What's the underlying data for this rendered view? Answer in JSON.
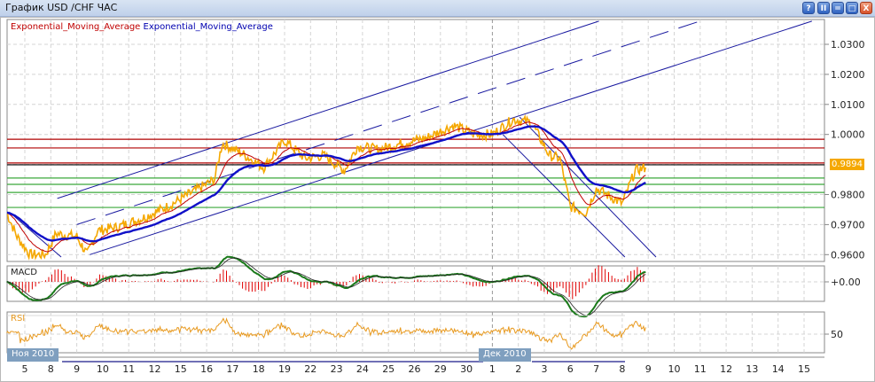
{
  "window": {
    "title": "График USD /CHF  ЧАС",
    "buttons": [
      "?",
      "II",
      "=",
      "□",
      "X"
    ]
  },
  "chart_data": {
    "type": "line",
    "title": "График USD /CHF  ЧАС",
    "legend": [
      {
        "label": "Exponential_Moving_Average",
        "color": "#c00000"
      },
      {
        "label": "Exponential_Moving_Average",
        "color": "#0000b0"
      }
    ],
    "x_ticks": [
      "5",
      "8",
      "9",
      "10",
      "11",
      "12",
      "15",
      "16",
      "17",
      "18",
      "19",
      "22",
      "23",
      "24",
      "25",
      "26",
      "29",
      "30",
      "1",
      "2",
      "3",
      "6",
      "7",
      "8",
      "9",
      "10",
      "11",
      "12",
      "13",
      "14",
      "15"
    ],
    "months": [
      {
        "label": "Ноя 2010",
        "index": 0
      },
      {
        "label": "Дек 2010",
        "index": 18
      }
    ],
    "y_ticks": [
      "1.0300",
      "1.0200",
      "1.0100",
      "1.0000",
      "0.9800",
      "0.9700",
      "0.9600"
    ],
    "y_tick_values": [
      1.03,
      1.02,
      1.01,
      1.0,
      0.98,
      0.97,
      0.96
    ],
    "ylim": [
      0.9555,
      1.0385
    ],
    "last_price": "0.9894",
    "price_keypoints": [
      [
        -0.7,
        0.974
      ],
      [
        -0.3,
        0.966
      ],
      [
        0.2,
        0.96
      ],
      [
        0.8,
        0.96
      ],
      [
        1.2,
        0.967
      ],
      [
        2.0,
        0.966
      ],
      [
        2.4,
        0.96
      ],
      [
        2.8,
        0.968
      ],
      [
        3.5,
        0.969
      ],
      [
        4.5,
        0.972
      ],
      [
        5.5,
        0.976
      ],
      [
        6.5,
        0.981
      ],
      [
        7.3,
        0.985
      ],
      [
        7.6,
        0.997
      ],
      [
        8.3,
        0.994
      ],
      [
        9.2,
        0.989
      ],
      [
        10.0,
        0.998
      ],
      [
        10.8,
        0.992
      ],
      [
        11.5,
        0.993
      ],
      [
        12.3,
        0.988
      ],
      [
        12.8,
        0.996
      ],
      [
        13.6,
        0.995
      ],
      [
        14.5,
        0.997
      ],
      [
        15.5,
        0.999
      ],
      [
        16.5,
        1.003
      ],
      [
        17.3,
        1.0
      ],
      [
        18.0,
        1.0
      ],
      [
        18.8,
        1.005
      ],
      [
        19.5,
        1.004
      ],
      [
        20.2,
        0.993
      ],
      [
        20.6,
        0.992
      ],
      [
        21.0,
        0.976
      ],
      [
        21.6,
        0.974
      ],
      [
        22.0,
        0.982
      ],
      [
        22.6,
        0.979
      ],
      [
        23.0,
        0.977
      ],
      [
        23.5,
        0.988
      ],
      [
        23.9,
        0.989
      ]
    ],
    "horizontal_levels": [
      {
        "value": 0.9984,
        "color": "#b00000"
      },
      {
        "value": 0.9955,
        "color": "#b00000"
      },
      {
        "value": 0.9905,
        "color": "#b00000"
      },
      {
        "value": 0.9899,
        "color": "#000000"
      },
      {
        "value": 0.9855,
        "color": "#3aa83a"
      },
      {
        "value": 0.9834,
        "color": "#3aa83a"
      },
      {
        "value": 0.9807,
        "color": "#3aa83a"
      },
      {
        "value": 0.9757,
        "color": "#3aa83a"
      }
    ],
    "trend_lines": [
      {
        "from": [
          1.25,
          0.9787
        ],
        "to": [
          22.1,
          1.0377
        ],
        "style": "solid"
      },
      {
        "from": [
          2.0,
          0.97
        ],
        "to": [
          26.2,
          1.0383
        ],
        "style": "dashed"
      },
      {
        "from": [
          2.5,
          0.96
        ],
        "to": [
          30.3,
          1.0377
        ],
        "style": "solid"
      },
      {
        "from": [
          18.4,
          1.0
        ],
        "to": [
          23.1,
          0.9592
        ],
        "style": "solid"
      },
      {
        "from": [
          19.05,
          1.0058
        ],
        "to": [
          24.3,
          0.9592
        ],
        "style": "solid"
      },
      {
        "from": [
          -0.6,
          0.9742
        ],
        "to": [
          1.4,
          0.9592
        ],
        "style": "solid"
      }
    ],
    "macd": {
      "label": "MACD",
      "tick": "+0.00",
      "range": [
        -0.004,
        0.004
      ]
    },
    "rsi": {
      "label": "RSI",
      "tick": "50",
      "range": [
        0,
        100
      ]
    }
  }
}
